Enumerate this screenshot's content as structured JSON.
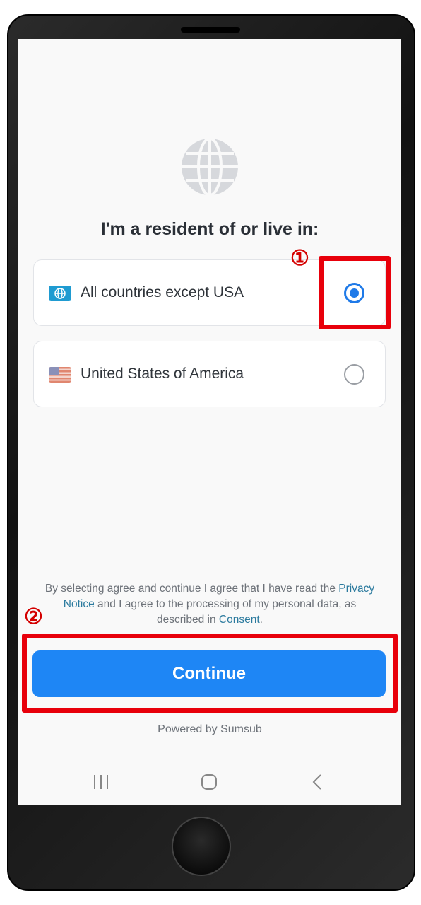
{
  "screen": {
    "title": "I'm a resident of or live in:",
    "options": [
      {
        "label": "All countries except USA",
        "icon": "globe-icon",
        "selected": true
      },
      {
        "label": "United States of America",
        "icon": "us-flag-icon",
        "selected": false
      }
    ],
    "legal": {
      "part1": "By selecting agree and continue I agree that I have read the ",
      "privacy_link": "Privacy Notice",
      "part2": " and I agree to the processing of my personal data, as described in ",
      "consent_link": "Consent",
      "part3": "."
    },
    "continue_label": "Continue",
    "powered_by": "Powered by Sumsub",
    "accent_color": "#1e86f5"
  },
  "annotations": {
    "step1": "①",
    "step2": "②",
    "color": "#e8000b"
  }
}
